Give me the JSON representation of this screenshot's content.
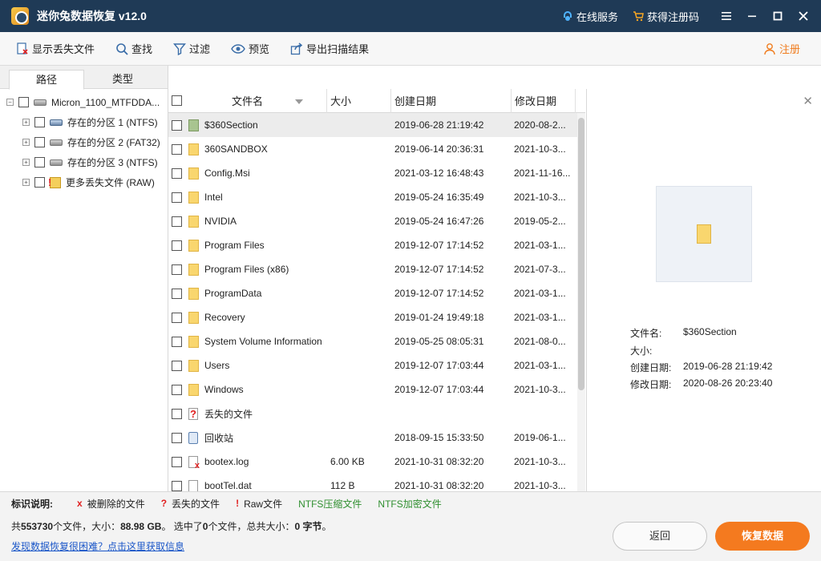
{
  "window": {
    "title": "迷你兔数据恢复 v12.0",
    "online_service": "在线服务",
    "get_code": "获得注册码"
  },
  "toolbar": {
    "show_lost": "显示丢失文件",
    "find": "查找",
    "filter": "过滤",
    "preview": "预览",
    "export": "导出扫描结果",
    "register": "注册"
  },
  "tabs": {
    "path": "路径",
    "type": "类型"
  },
  "tree": {
    "root": "Micron_1100_MTFDDA...",
    "items": [
      {
        "label": "存在的分区 1 (NTFS)",
        "icon": "partition-drive-icon"
      },
      {
        "label": "存在的分区 2 (FAT32)",
        "icon": "drive-icon"
      },
      {
        "label": "存在的分区 3 (NTFS)",
        "icon": "drive-icon"
      },
      {
        "label": "更多丢失文件 (RAW)",
        "icon": "lost-files-icon"
      }
    ]
  },
  "columns": {
    "name": "文件名",
    "size": "大小",
    "created": "创建日期",
    "modified": "修改日期"
  },
  "files": [
    {
      "name": "$360Section",
      "size": "",
      "created": "2019-06-28 21:19:42",
      "modified": "2020-08-2...",
      "icon": "folder-green",
      "selected": true
    },
    {
      "name": "360SANDBOX",
      "size": "",
      "created": "2019-06-14 20:36:31",
      "modified": "2021-10-3...",
      "icon": "folder"
    },
    {
      "name": "Config.Msi",
      "size": "",
      "created": "2021-03-12 16:48:43",
      "modified": "2021-11-16...",
      "icon": "folder"
    },
    {
      "name": "Intel",
      "size": "",
      "created": "2019-05-24 16:35:49",
      "modified": "2021-10-3...",
      "icon": "folder"
    },
    {
      "name": "NVIDIA",
      "size": "",
      "created": "2019-05-24 16:47:26",
      "modified": "2019-05-2...",
      "icon": "folder"
    },
    {
      "name": "Program Files",
      "size": "",
      "created": "2019-12-07 17:14:52",
      "modified": "2021-03-1...",
      "icon": "folder"
    },
    {
      "name": "Program Files (x86)",
      "size": "",
      "created": "2019-12-07 17:14:52",
      "modified": "2021-07-3...",
      "icon": "folder"
    },
    {
      "name": "ProgramData",
      "size": "",
      "created": "2019-12-07 17:14:52",
      "modified": "2021-03-1...",
      "icon": "folder"
    },
    {
      "name": "Recovery",
      "size": "",
      "created": "2019-01-24 19:49:18",
      "modified": "2021-03-1...",
      "icon": "folder"
    },
    {
      "name": "System Volume Information",
      "size": "",
      "created": "2019-05-25 08:05:31",
      "modified": "2021-08-0...",
      "icon": "folder"
    },
    {
      "name": "Users",
      "size": "",
      "created": "2019-12-07 17:03:44",
      "modified": "2021-03-1...",
      "icon": "folder"
    },
    {
      "name": "Windows",
      "size": "",
      "created": "2019-12-07 17:03:44",
      "modified": "2021-10-3...",
      "icon": "folder"
    },
    {
      "name": "丢失的文件",
      "size": "",
      "created": "",
      "modified": "",
      "icon": "lost"
    },
    {
      "name": "回收站",
      "size": "",
      "created": "2018-09-15 15:33:50",
      "modified": "2019-06-1...",
      "icon": "recycle"
    },
    {
      "name": "bootex.log",
      "size": "6.00 KB",
      "created": "2021-10-31 08:32:20",
      "modified": "2021-10-3...",
      "icon": "deleted"
    },
    {
      "name": "bootTel.dat",
      "size": "112 B",
      "created": "2021-10-31 08:32:20",
      "modified": "2021-10-3...",
      "icon": "file"
    }
  ],
  "preview": {
    "name_label": "文件名:",
    "name_value": "$360Section",
    "size_label": "大小:",
    "size_value": "",
    "created_label": "创建日期:",
    "created_value": "2019-06-28 21:19:42",
    "modified_label": "修改日期:",
    "modified_value": "2020-08-26 20:23:40"
  },
  "legend": {
    "title": "标识说明:",
    "deleted": "被删除的文件",
    "lost": "丢失的文件",
    "raw": "Raw文件",
    "ntfs_compressed": "NTFS压缩文件",
    "ntfs_encrypted": "NTFS加密文件"
  },
  "footer": {
    "stats_prefix": "共",
    "total_files": "553730",
    "stats_mid1": "个文件，大小：",
    "total_size": "88.98 GB",
    "stats_mid2": "。 选中了",
    "selected_count": "0",
    "stats_mid3": "个文件，总共大小：",
    "selected_size": "0 字节",
    "stats_end": "。",
    "help_link": "发现数据恢复很困难？点击这里获取信息",
    "back": "返回",
    "recover": "恢复数据"
  },
  "colors": {
    "titlebar": "#1f3a56",
    "accent": "#f47a1f",
    "link": "#1a56c8",
    "ntfs_green": "#2f8f2f",
    "mark_red": "#e02020"
  }
}
